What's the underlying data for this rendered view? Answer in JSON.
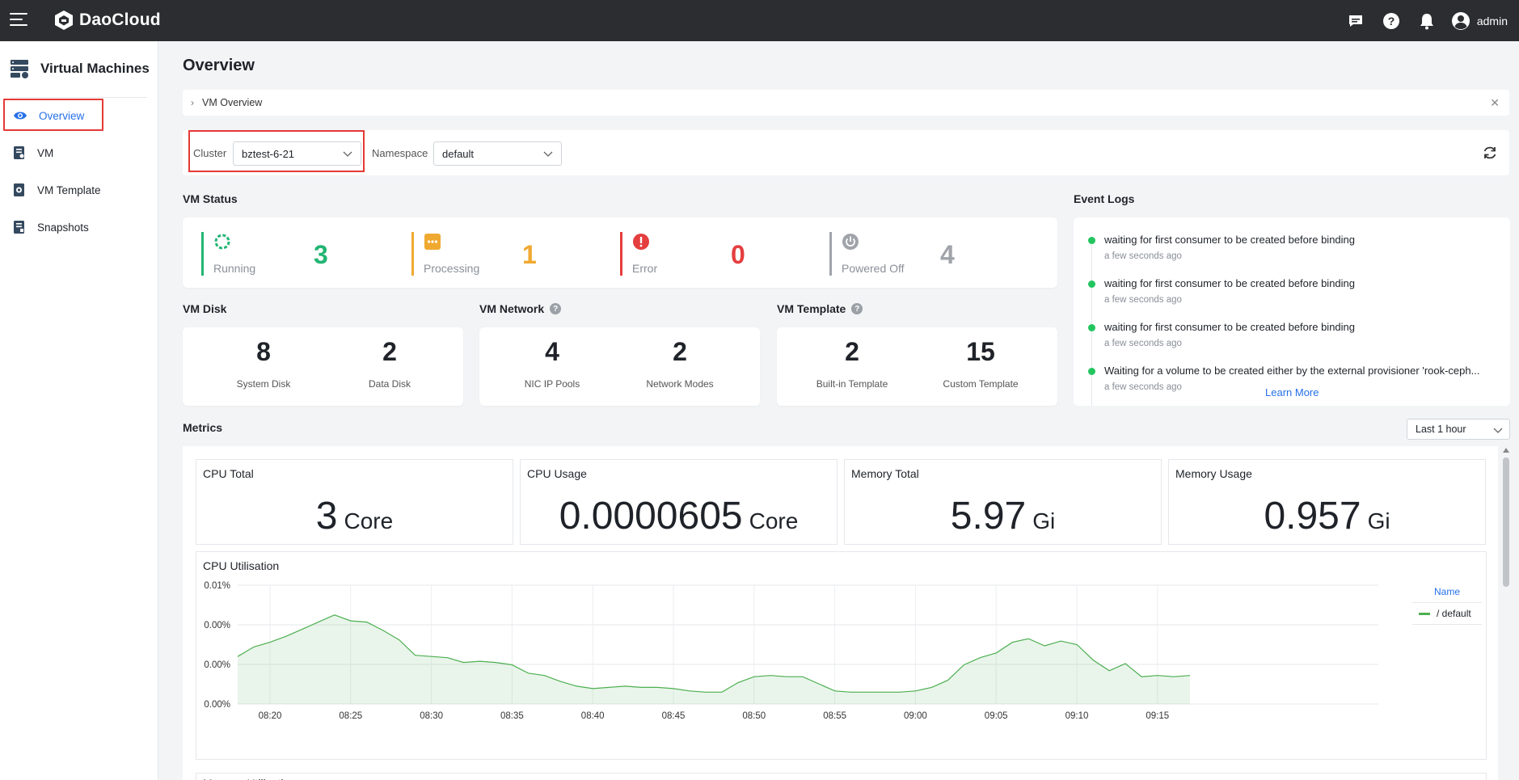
{
  "topbar": {
    "brand": "DaoCloud",
    "user_name": "admin"
  },
  "sidebar": {
    "title": "Virtual Machines",
    "items": [
      {
        "label": "Overview",
        "icon": "eye-icon",
        "active": true
      },
      {
        "label": "VM",
        "icon": "vm-icon",
        "active": false
      },
      {
        "label": "VM Template",
        "icon": "template-icon",
        "active": false
      },
      {
        "label": "Snapshots",
        "icon": "snapshot-icon",
        "active": false
      }
    ]
  },
  "page": {
    "title": "Overview",
    "banner": "VM Overview"
  },
  "filters": {
    "cluster_label": "Cluster",
    "cluster_value": "bztest-6-21",
    "namespace_label": "Namespace",
    "namespace_value": "default"
  },
  "vm_status": {
    "title": "VM Status",
    "items": [
      {
        "label": "Running",
        "value": "3",
        "color": "#22b573"
      },
      {
        "label": "Processing",
        "value": "1",
        "color": "#f0a930"
      },
      {
        "label": "Error",
        "value": "0",
        "color": "#e53e3e"
      },
      {
        "label": "Powered Off",
        "value": "4",
        "color": "#a0a4aa"
      }
    ]
  },
  "vm_disk": {
    "title": "VM Disk",
    "items": [
      {
        "value": "8",
        "label": "System Disk"
      },
      {
        "value": "2",
        "label": "Data Disk"
      }
    ]
  },
  "vm_network": {
    "title": "VM Network",
    "items": [
      {
        "value": "4",
        "label": "NIC IP Pools"
      },
      {
        "value": "2",
        "label": "Network Modes"
      }
    ]
  },
  "vm_template": {
    "title": "VM Template",
    "items": [
      {
        "value": "2",
        "label": "Built-in Template"
      },
      {
        "value": "15",
        "label": "Custom Template"
      }
    ]
  },
  "event_logs": {
    "title": "Event Logs",
    "items": [
      {
        "text": "waiting for first consumer to be created before binding",
        "time": "a few seconds ago"
      },
      {
        "text": "waiting for first consumer to be created before binding",
        "time": "a few seconds ago"
      },
      {
        "text": "waiting for first consumer to be created before binding",
        "time": "a few seconds ago"
      },
      {
        "text": "Waiting for a volume to be created either by the external provisioner 'rook-ceph...",
        "time": "a few seconds ago"
      }
    ],
    "learn_more": "Learn More"
  },
  "metrics": {
    "title": "Metrics",
    "range": "Last 1 hour",
    "cards": [
      {
        "title": "CPU Total",
        "value": "3",
        "unit": "Core"
      },
      {
        "title": "CPU Usage",
        "value": "0.0000605",
        "unit": "Core"
      },
      {
        "title": "Memory Total",
        "value": "5.97",
        "unit": "Gi"
      },
      {
        "title": "Memory Usage",
        "value": "0.957",
        "unit": "Gi"
      }
    ],
    "memory_title": "Memory Utilisation"
  },
  "chart_data": {
    "type": "area",
    "title": "CPU Utilisation",
    "legend_title": "Name",
    "series": [
      {
        "name": "/ default",
        "color": "#4caf50",
        "values": [
          0.004,
          0.0048,
          0.0052,
          0.0057,
          0.0063,
          0.0069,
          0.0075,
          0.007,
          0.0069,
          0.0062,
          0.0054,
          0.0041,
          0.004,
          0.0039,
          0.0035,
          0.0036,
          0.0035,
          0.0033,
          0.0026,
          0.0024,
          0.0019,
          0.0015,
          0.0013,
          0.0014,
          0.0015,
          0.0014,
          0.0014,
          0.0013,
          0.0011,
          0.001,
          0.001,
          0.0018,
          0.0023,
          0.0024,
          0.0023,
          0.0023,
          0.0017,
          0.0011,
          0.001,
          0.001,
          0.001,
          0.001,
          0.0011,
          0.0014,
          0.002,
          0.0033,
          0.0039,
          0.0043,
          0.0052,
          0.0055,
          0.0049,
          0.0053,
          0.005,
          0.0037,
          0.0028,
          0.0034,
          0.0023,
          0.0024,
          0.0023,
          0.0024
        ]
      }
    ],
    "x_ticks": [
      "08:20",
      "08:25",
      "08:30",
      "08:35",
      "08:40",
      "08:45",
      "08:50",
      "08:55",
      "09:00",
      "09:05",
      "09:10",
      "09:15"
    ],
    "y_ticks": [
      "0.01%",
      "0.00%",
      "0.00%",
      "0.00%"
    ],
    "ylim": [
      0,
      0.01
    ],
    "grid": true,
    "legend": "right"
  }
}
